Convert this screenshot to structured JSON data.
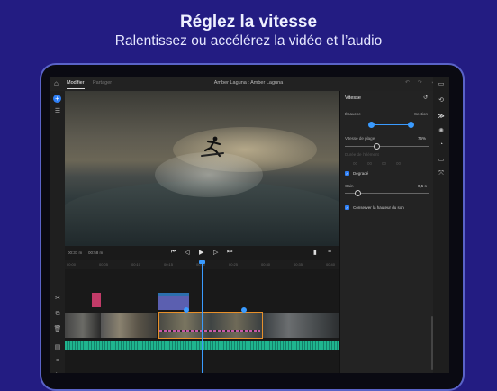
{
  "headline": {
    "title": "Réglez la vitesse",
    "subtitle": "Ralentissez ou accélérez la vidéo et l’audio"
  },
  "app": {
    "tabs": [
      "Modifier",
      "Partager"
    ],
    "project_title": "Amber Laguna : Amber Laguna",
    "timecode_current": "00:37 m",
    "timecode_total": "00:58 m",
    "ruler_marks": [
      "00:00",
      "00:05",
      "00:10",
      "00:15",
      "00:20",
      "00:25",
      "00:30",
      "00:35",
      "00:40"
    ]
  },
  "panel": {
    "title": "Vitesse",
    "ramp_in_label": "Ébauche",
    "ramp_out_label": "Section",
    "playback_speed_label": "Vitesse de plage",
    "playback_speed_value": "76%",
    "source_range_label": "Durée de l’élément",
    "source_range_values": [
      "00",
      "00",
      "00",
      "00"
    ],
    "fade_label": "Dégradé",
    "gain_label": "Gain",
    "gain_value": "0,5 s",
    "preserve_pitch_label": "Conserver la hauteur du son",
    "fade_checked": true,
    "preserve_pitch_checked": true,
    "playback_speed_level": 0.76
  },
  "icons": {
    "left": [
      "home-icon",
      "add-icon",
      "layers-icon",
      "scissors-icon",
      "duplicate-icon",
      "trash-icon",
      "filmstrip-icon",
      "tracks-icon",
      "transitions-icon"
    ],
    "right": [
      "comment-icon",
      "rotate-icon",
      "speed-icon",
      "color-icon",
      "gauge-icon",
      "crop-icon",
      "transform-icon"
    ]
  },
  "colors": {
    "background": "#231c82",
    "accent": "#2e7ff5",
    "audio_wave": "#1fb58f",
    "title_clip": "#c23b68",
    "selected_clip": "#e8902a"
  }
}
